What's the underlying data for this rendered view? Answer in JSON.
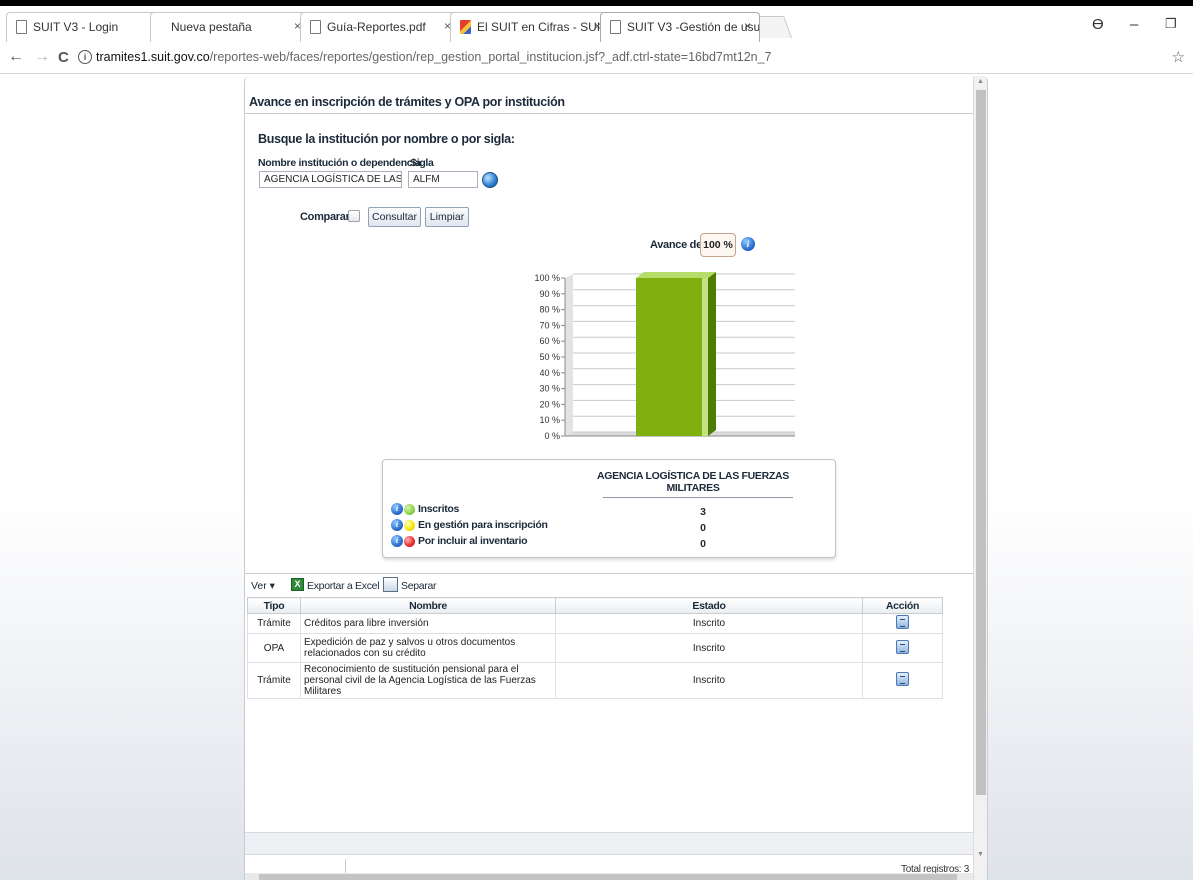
{
  "browser": {
    "tabs": [
      {
        "label": "SUIT V3 - Login",
        "close": "×"
      },
      {
        "label": "Nueva pestaña",
        "close": "×"
      },
      {
        "label": "Guía-Reportes.pdf",
        "close": "×"
      },
      {
        "label": "El SUIT en Cifras - SUIT",
        "close": "×"
      },
      {
        "label": "SUIT V3 -Gestión de usu",
        "close": "×"
      }
    ],
    "url_host": "tramites1.suit.gov.co",
    "url_path": "/reportes-web/faces/reportes/gestion/rep_gestion_portal_institucion.jsf?_adf.ctrl-state=16bd7mt12n_7",
    "controls": {
      "back": "←",
      "forward": "→",
      "reload": "C",
      "info": "i",
      "star": "☆",
      "profile": "ϴ",
      "minimize": "–",
      "restore": "❐"
    }
  },
  "page": {
    "title": "Avance en inscripción de trámites y OPA por institución",
    "search_heading": "Busque la institución por nombre o por sigla:",
    "label_institucion": "Nombre institución o dependencia",
    "label_sigla": "Sigla",
    "value_institucion": "AGENCIA LOGÍSTICA DE LAS FUER.",
    "value_sigla": "ALFM",
    "label_comparar": "Comparar",
    "btn_consultar": "Consultar",
    "btn_limpiar": "Limpiar",
    "label_avance": "Avance de :",
    "value_avance": "100 %",
    "info_glyph": "i"
  },
  "chart_data": {
    "type": "bar",
    "categories": [
      "AGENCIA LOGÍSTICA DE LAS FUERZAS MILITARES"
    ],
    "values": [
      100
    ],
    "ytick_labels": [
      "0 %",
      "10 %",
      "20 %",
      "30 %",
      "40 %",
      "50 %",
      "60 %",
      "70 %",
      "80 %",
      "90 %",
      "100 %"
    ],
    "ylim": [
      0,
      100
    ],
    "grid": true,
    "bar_color": "#7fb010",
    "title": "",
    "xlabel": "",
    "ylabel": ""
  },
  "summary": {
    "column_header": "AGENCIA LOGÍSTICA DE LAS FUERZAS MILITARES",
    "rows": [
      {
        "label": "Inscritos",
        "value": "3",
        "color": "#8bd04a"
      },
      {
        "label": "En gestión para inscripción",
        "value": "0",
        "color": "#f5e600"
      },
      {
        "label": "Por incluir al inventario",
        "value": "0",
        "color": "#e8262b"
      }
    ]
  },
  "toolbar": {
    "ver": "Ver ▾",
    "exportar": "Exportar a Excel",
    "excel_glyph": "X",
    "separar": "Separar"
  },
  "grid": {
    "headers": [
      "Tipo",
      "Nombre",
      "Estado",
      "Acción"
    ],
    "rows": [
      {
        "tipo": "Trámite",
        "nombre": "Créditos para libre inversión",
        "estado": "Inscrito"
      },
      {
        "tipo": "OPA",
        "nombre": "Expedición de paz y salvos u otros documentos relacionados con su crédito",
        "estado": "Inscrito"
      },
      {
        "tipo": "Trámite",
        "nombre": "Reconocimiento de sustitución pensional para el personal civil de la Agencia Logística de las Fuerzas Militares",
        "estado": "Inscrito"
      }
    ],
    "total": "Total registros: 3"
  }
}
